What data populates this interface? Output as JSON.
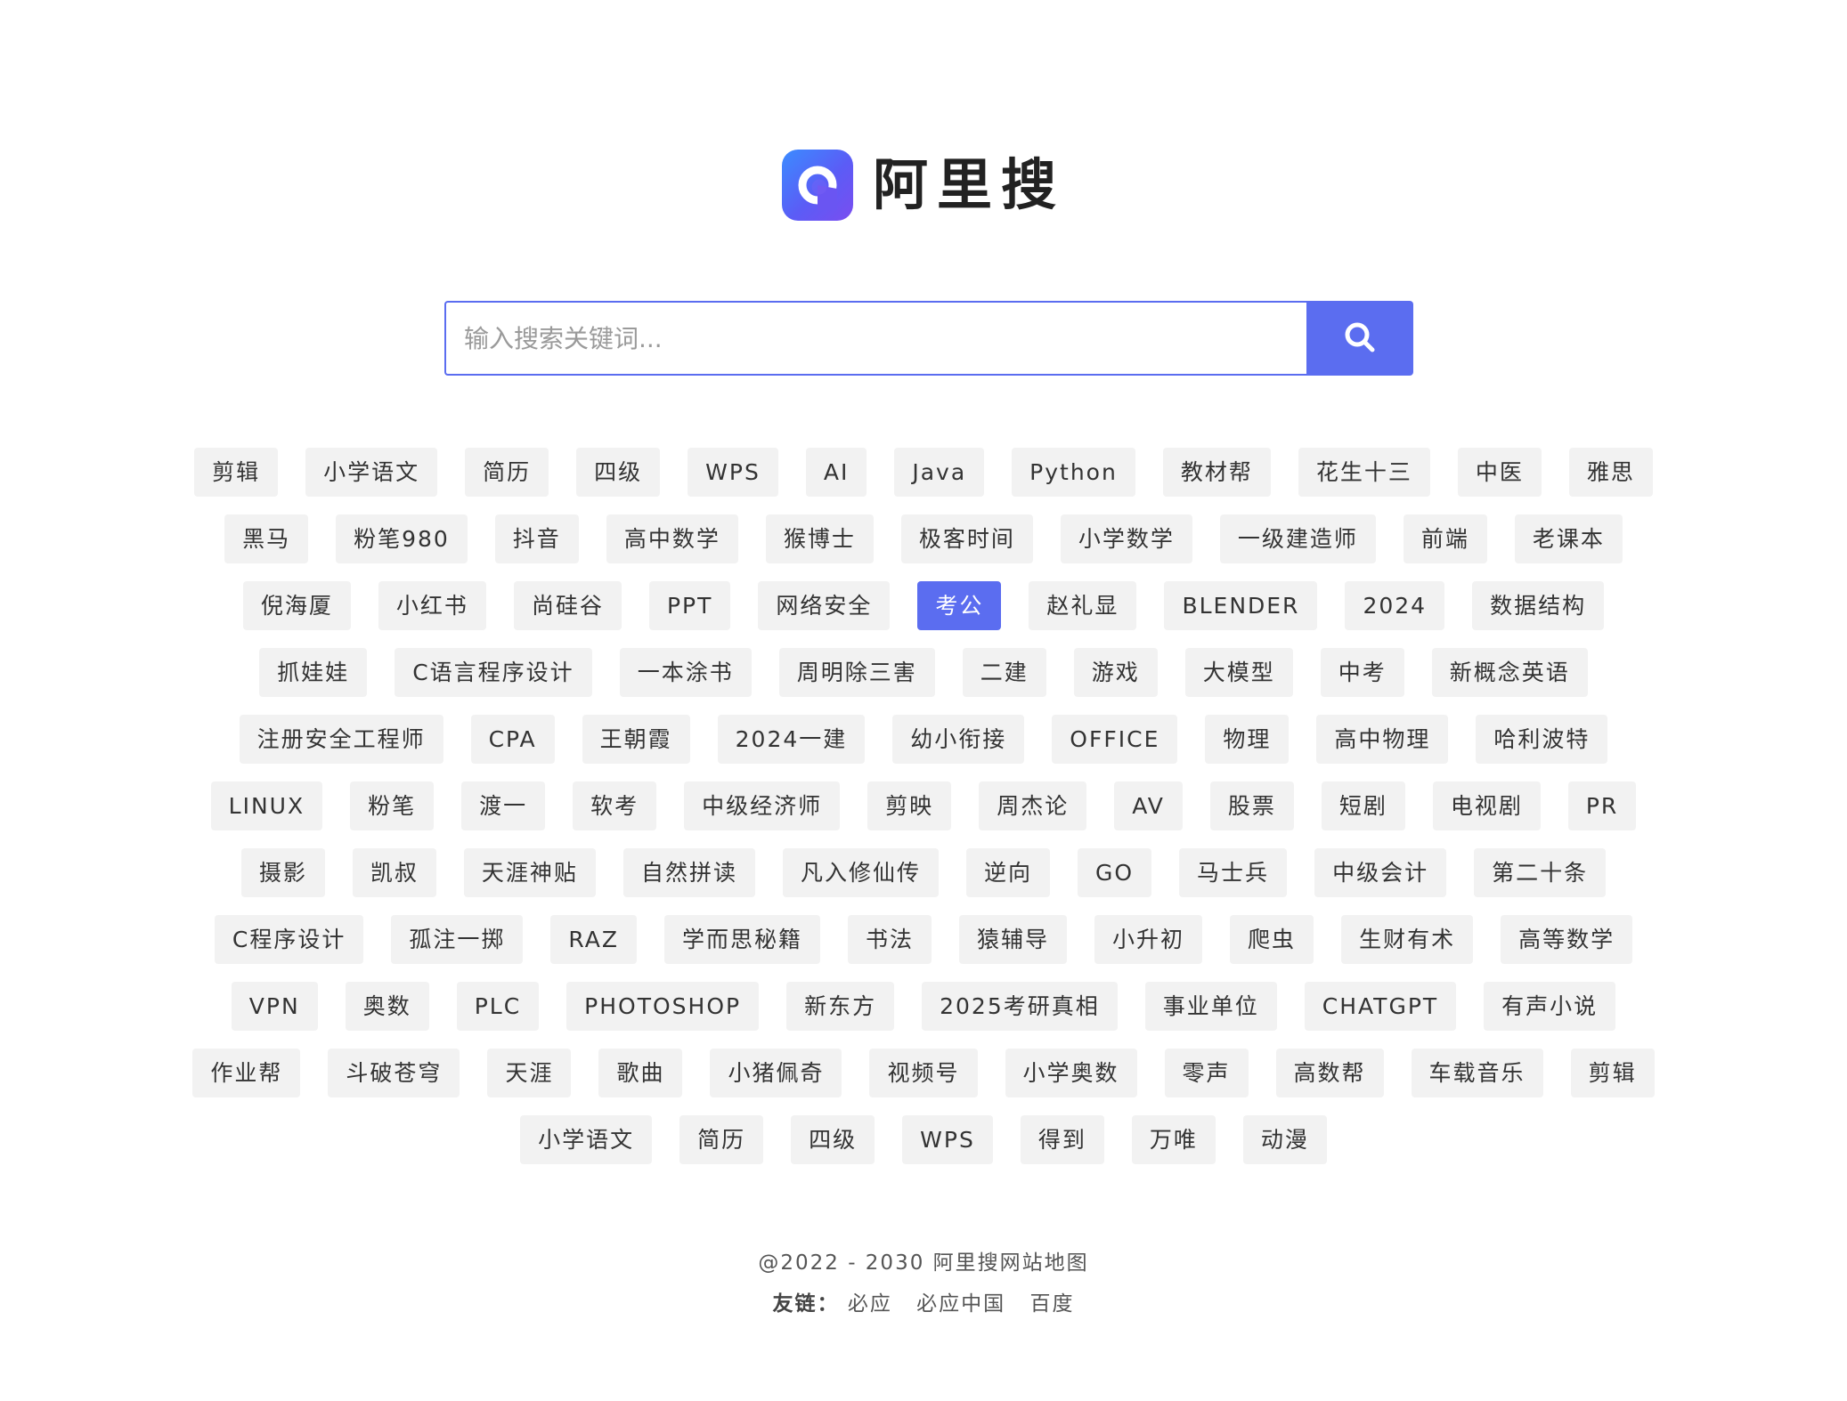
{
  "brand": {
    "name": "阿里搜"
  },
  "search": {
    "placeholder": "输入搜索关键词...",
    "value": ""
  },
  "tags": [
    "剪辑",
    "小学语文",
    "简历",
    "四级",
    "WPS",
    "AI",
    "Java",
    "Python",
    "教材帮",
    "花生十三",
    "中医",
    "雅思",
    "黑马",
    "粉笔980",
    "抖音",
    "高中数学",
    "猴博士",
    "极客时间",
    "小学数学",
    "一级建造师",
    "前端",
    "老课本",
    "倪海厦",
    "小红书",
    "尚硅谷",
    "PPT",
    "网络安全",
    "考公",
    "赵礼显",
    "BLENDER",
    "2024",
    "数据结构",
    "抓娃娃",
    "C语言程序设计",
    "一本涂书",
    "周明除三害",
    "二建",
    "游戏",
    "大模型",
    "中考",
    "新概念英语",
    "注册安全工程师",
    "CPA",
    "王朝霞",
    "2024一建",
    "幼小衔接",
    "OFFICE",
    "物理",
    "高中物理",
    "哈利波特",
    "LINUX",
    "粉笔",
    "渡一",
    "软考",
    "中级经济师",
    "剪映",
    "周杰论",
    "AV",
    "股票",
    "短剧",
    "电视剧",
    "PR",
    "摄影",
    "凯叔",
    "天涯神贴",
    "自然拼读",
    "凡入修仙传",
    "逆向",
    "GO",
    "马士兵",
    "中级会计",
    "第二十条",
    "C程序设计",
    "孤注一掷",
    "RAZ",
    "学而思秘籍",
    "书法",
    "猿辅导",
    "小升初",
    "爬虫",
    "生财有术",
    "高等数学",
    "VPN",
    "奥数",
    "PLC",
    "PHOTOSHOP",
    "新东方",
    "2025考研真相",
    "事业单位",
    "CHATGPT",
    "有声小说",
    "作业帮",
    "斗破苍穹",
    "天涯",
    "歌曲",
    "小猪佩奇",
    "视频号",
    "小学奥数",
    "零声",
    "高数帮",
    "车载音乐",
    "剪辑",
    "小学语文",
    "简历",
    "四级",
    "WPS",
    "得到",
    "万唯",
    "动漫"
  ],
  "active_tag": "考公",
  "footer": {
    "copyright": "@2022 - 2030 阿里搜网站地图",
    "friends_label": "友链：",
    "friends": [
      "必应",
      "必应中国",
      "百度"
    ]
  },
  "colors": {
    "accent": "#5b6df0",
    "tag_background": "#f2f2f2",
    "text": "#333333"
  },
  "icons": {
    "logo": "ali-search-logo-icon",
    "search": "search-icon"
  }
}
